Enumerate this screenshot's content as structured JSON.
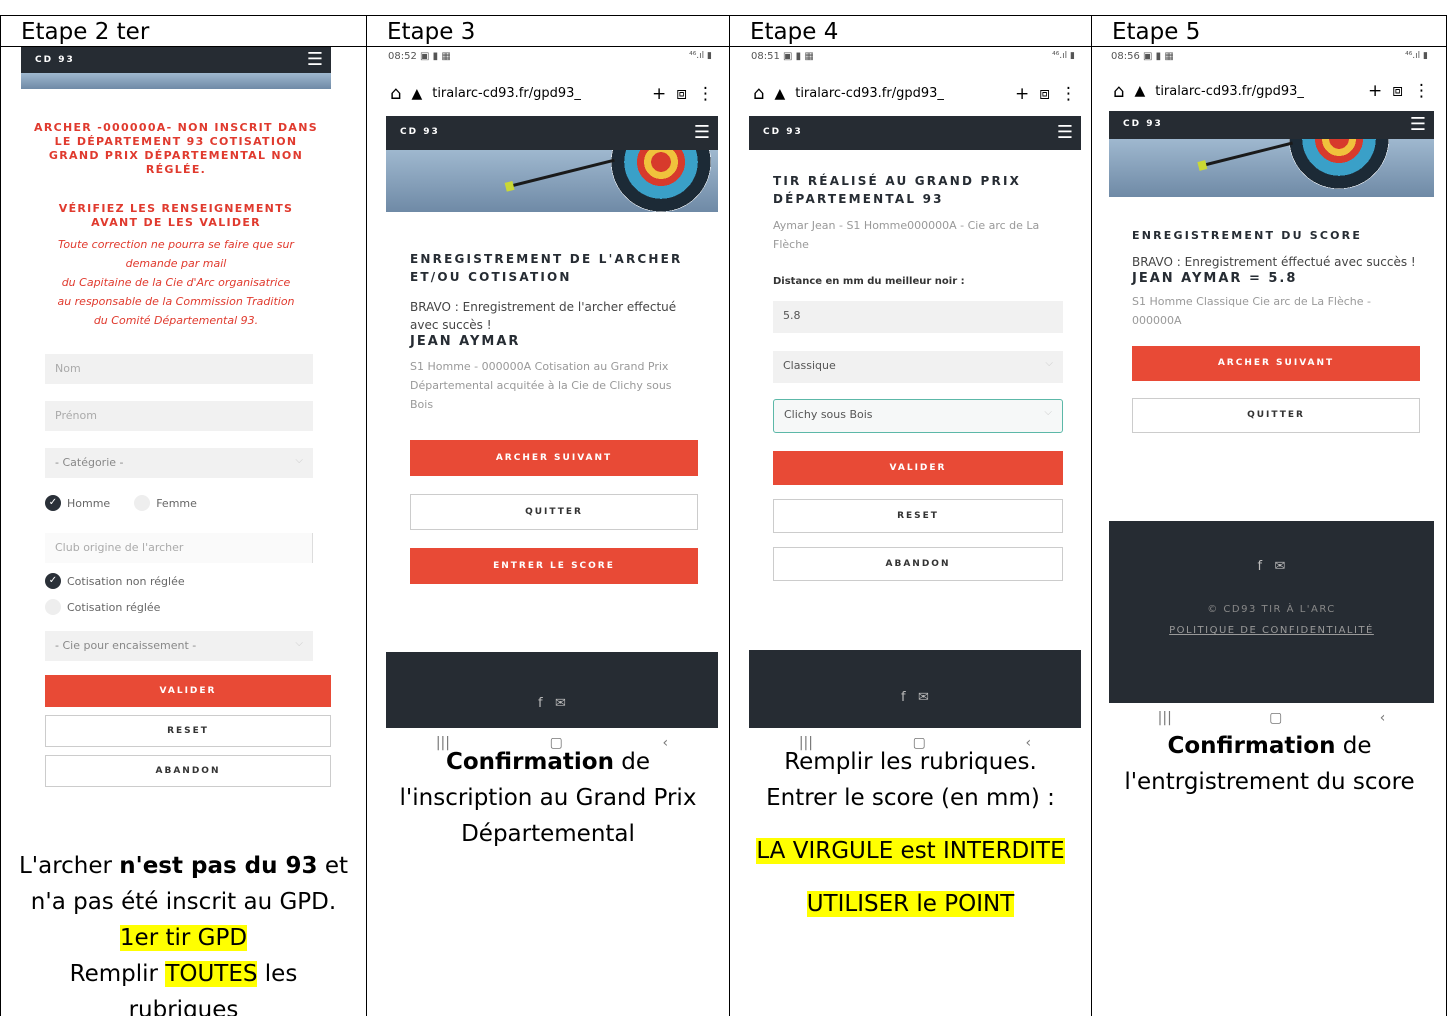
{
  "columns": {
    "c1": {
      "header": "Etape 2 ter",
      "site": "CD 93",
      "error_title": "ARCHER -000000A- NON INSCRIT DANS LE DÉPARTEMENT 93 COTISATION GRAND PRIX DÉPARTEMENTAL NON RÉGLÉE.",
      "verify_title": "VÉRIFIEZ LES RENSEIGNEMENTS AVANT DE LES VALIDER",
      "note_lines": [
        "Toute correction ne pourra se faire que sur",
        "demande par mail",
        "du Capitaine de la Cie d'Arc organisatrice",
        "au responsable de la Commission Tradition",
        "du Comité Départemental 93."
      ],
      "placeholder_nom": "Nom",
      "placeholder_prenom": "Prénom",
      "select_categorie": "- Catégorie -",
      "radio_homme": "Homme",
      "radio_femme": "Femme",
      "placeholder_club": "Club origine de l'archer",
      "radio_cotis_non": "Cotisation non réglée",
      "radio_cotis_ok": "Cotisation réglée",
      "select_cie": "- Cie pour encaissement -",
      "btn_valider": "VALIDER",
      "btn_reset": "RESET",
      "btn_abandon": "ABANDON",
      "caption_1a": "L'archer ",
      "caption_1b": "n'est pas du 93",
      "caption_1c": " et",
      "caption_2": "n'a pas été inscrit au GPD.",
      "caption_3": "1er tir GPD",
      "caption_4a": "Remplir ",
      "caption_4b": "TOUTES",
      "caption_4c": " les",
      "caption_5": "rubriques"
    },
    "c2": {
      "header": "Etape 3",
      "time": "08:52",
      "url": "tiralarc-cd93.fr/gpd93_",
      "site": "CD 93",
      "title": "ENREGISTREMENT DE L'ARCHER ET/OU COTISATION",
      "message": "BRAVO : Enregistrement de l'archer effectué avec succès !",
      "name": "JEAN AYMAR",
      "details": "S1 Homme - 000000A Cotisation au Grand Prix Départemental acquitée à la Cie de Clichy sous Bois",
      "btn_suivant": "ARCHER SUIVANT",
      "btn_quitter": "QUITTER",
      "btn_score": "ENTRER LE SCORE",
      "caption_1a": "Confirmation",
      "caption_1b": " de",
      "caption_2": "l'inscription au Grand Prix",
      "caption_3": "Départemental"
    },
    "c3": {
      "header": "Etape 4",
      "time": "08:51",
      "url": "tiralarc-cd93.fr/gpd93_",
      "site": "CD 93",
      "title": "TIR RÉALISÉ AU GRAND PRIX DÉPARTEMENTAL 93",
      "archer": "Aymar Jean - S1 Homme000000A - Cie arc de La Flèche",
      "label_distance": "Distance en mm du meilleur noir :",
      "value_distance": "5.8",
      "select_arc": "Classique",
      "select_cie": "Clichy sous Bois",
      "btn_valider": "VALIDER",
      "btn_reset": "RESET",
      "btn_abandon": "ABANDON",
      "caption_1": "Remplir les rubriques.",
      "caption_2": "Entrer le score (en mm) :",
      "caption_3": "LA VIRGULE est INTERDITE",
      "caption_4": "UTILISER le POINT"
    },
    "c4": {
      "header": "Etape 5",
      "time": "08:56",
      "url": "tiralarc-cd93.fr/gpd93_",
      "site": "CD 93",
      "title": "ENREGISTREMENT DU SCORE",
      "message": "BRAVO : Enregistrement éffectué avec succès !",
      "score_line": "JEAN AYMAR = 5.8",
      "details": "S1 Homme Classique Cie arc de La Flèche - 000000A",
      "btn_suivant": "ARCHER SUIVANT",
      "btn_quitter": "QUITTER",
      "copyright": "© CD93 TIR À L'ARC",
      "privacy": "POLITIQUE DE CONFIDENTIALITÉ",
      "caption_1a": "Confirmation",
      "caption_1b": " de",
      "caption_2": "l'entrgistrement du score"
    }
  },
  "colors": {
    "red": "#e84a36",
    "dark": "#262c33",
    "highlight": "#ffff00"
  }
}
